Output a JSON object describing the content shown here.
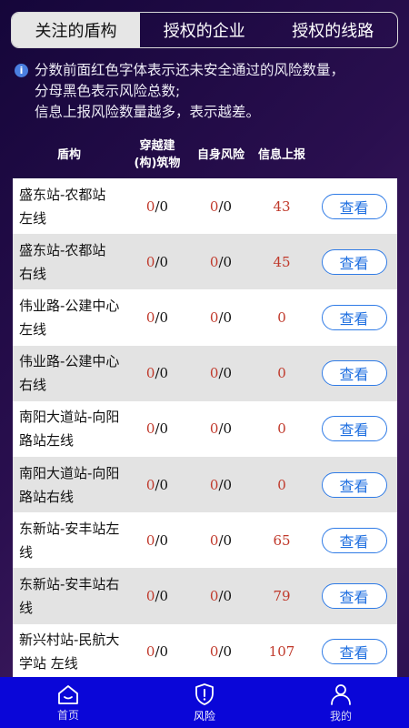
{
  "segments": [
    {
      "label": "关注的盾构"
    },
    {
      "label": "授权的企业"
    },
    {
      "label": "授权的线路"
    }
  ],
  "notice": {
    "lines": [
      "分数前面红色字体表示还未安全通过的风险数量，",
      "分母黑色表示风险总数;",
      "信息上报风险数量越多，表示越差。"
    ]
  },
  "table": {
    "headers": {
      "shield": "盾构",
      "crossing_1": "穿越建",
      "crossing_2": "(构)筑物",
      "own_risk": "自身风险",
      "report": "信息上报"
    },
    "rows": [
      {
        "name1": "盛东站-农都站",
        "name2": "左线",
        "cross_red": "0",
        "cross_total": "/0",
        "own_red": "0",
        "own_total": "/0",
        "report": "43",
        "action": "查看"
      },
      {
        "name1": "盛东站-农都站",
        "name2": "右线",
        "cross_red": "0",
        "cross_total": "/0",
        "own_red": "0",
        "own_total": "/0",
        "report": "45",
        "action": "查看"
      },
      {
        "name1": "伟业路-公建中心",
        "name2": "左线",
        "cross_red": "0",
        "cross_total": "/0",
        "own_red": "0",
        "own_total": "/0",
        "report": "0",
        "action": "查看"
      },
      {
        "name1": "伟业路-公建中心",
        "name2": "右线",
        "cross_red": "0",
        "cross_total": "/0",
        "own_red": "0",
        "own_total": "/0",
        "report": "0",
        "action": "查看"
      },
      {
        "name1": "南阳大道站-向阳",
        "name2": "路站左线",
        "cross_red": "0",
        "cross_total": "/0",
        "own_red": "0",
        "own_total": "/0",
        "report": "0",
        "action": "查看"
      },
      {
        "name1": "南阳大道站-向阳",
        "name2": "路站右线",
        "cross_red": "0",
        "cross_total": "/0",
        "own_red": "0",
        "own_total": "/0",
        "report": "0",
        "action": "查看"
      },
      {
        "name1": "东新站-安丰站左",
        "name2": "线",
        "cross_red": "0",
        "cross_total": "/0",
        "own_red": "0",
        "own_total": "/0",
        "report": "65",
        "action": "查看"
      },
      {
        "name1": "东新站-安丰站右",
        "name2": "线",
        "cross_red": "0",
        "cross_total": "/0",
        "own_red": "0",
        "own_total": "/0",
        "report": "79",
        "action": "查看"
      },
      {
        "name1": "新兴村站-民航大",
        "name2": "学站 左线",
        "cross_red": "0",
        "cross_total": "/0",
        "own_red": "0",
        "own_total": "/0",
        "report": "107",
        "action": "查看"
      }
    ]
  },
  "tabbar": [
    {
      "label": "首页",
      "icon": "home-icon"
    },
    {
      "label": "风险",
      "icon": "shield-alert-icon"
    },
    {
      "label": "我的",
      "icon": "user-icon"
    }
  ],
  "colors": {
    "tabbar_bg": "#0a06d8",
    "risk_red": "#c0392b",
    "button_blue": "#2f7be6"
  }
}
